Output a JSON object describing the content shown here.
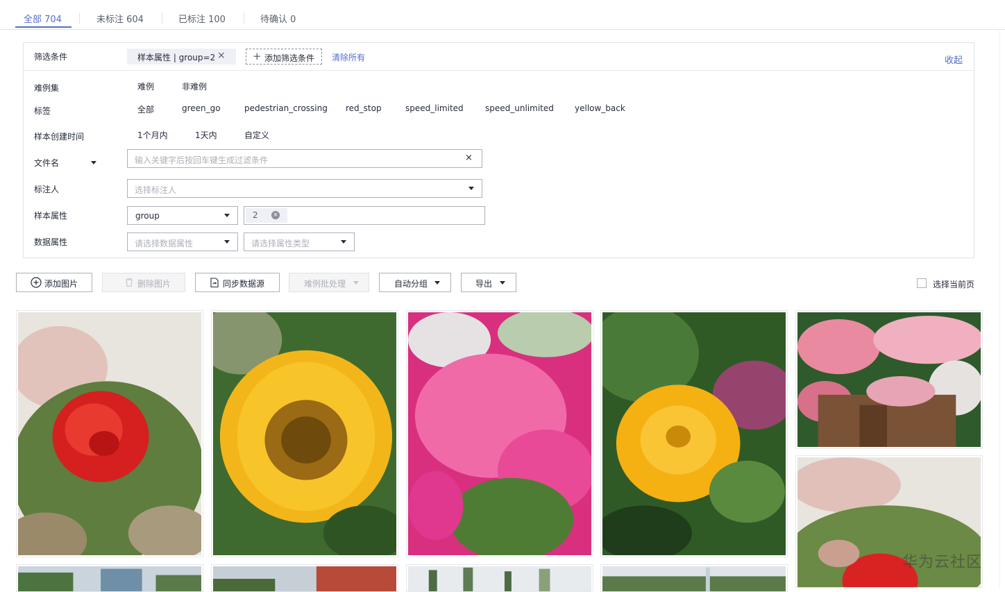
{
  "tabs": [
    {
      "label": "全部 704",
      "active": true
    },
    {
      "label": "未标注 604",
      "active": false
    },
    {
      "label": "已标注 100",
      "active": false
    },
    {
      "label": "待确认 0",
      "active": false
    }
  ],
  "filter": {
    "conditions_label": "筛选条件",
    "active_chip": "样本属性 | group=2",
    "add_condition": "添加筛选条件",
    "clear_all": "清除所有",
    "collapse": "收起",
    "hard_example_label": "难例集",
    "hard_example_options": [
      "难例",
      "非难例"
    ],
    "tags_label": "标签",
    "tag_options": [
      "全部",
      "green_go",
      "pedestrian_crossing",
      "red_stop",
      "speed_limited",
      "speed_unlimited",
      "yellow_back"
    ],
    "created_time_label": "样本创建时间",
    "created_time_options": [
      "1个月内",
      "1天内",
      "自定义"
    ],
    "filename_label": "文件名",
    "filename_placeholder": "输入关键字后按回车键生成过滤条件",
    "annotator_label": "标注人",
    "annotator_placeholder": "选择标注人",
    "sample_attr_label": "样本属性",
    "sample_attr_key": "group",
    "sample_attr_value": "2",
    "data_attr_label": "数据属性",
    "data_attr_placeholder": "请选择数据属性",
    "attr_type_placeholder": "请选择属性类型"
  },
  "toolbar": {
    "add_image": "添加图片",
    "delete_image": "删除图片",
    "sync_source": "同步数据源",
    "hard_batch": "难例批处理",
    "auto_group": "自动分组",
    "export": "导出",
    "select_page": "选择当前页"
  },
  "gallery": [
    {
      "subject": "red rose",
      "colors": [
        "#d92323",
        "#5b7a3a",
        "#e6e2dc"
      ]
    },
    {
      "subject": "sunflower",
      "colors": [
        "#f2b51b",
        "#8a5a12",
        "#3f6a2e"
      ]
    },
    {
      "subject": "pink cineraria",
      "colors": [
        "#e0378f",
        "#f27ab8",
        "#4d7a36"
      ]
    },
    {
      "subject": "yellow zinnia",
      "colors": [
        "#f5b213",
        "#3f6d2c",
        "#1f3d1a"
      ]
    },
    {
      "subject": "rose garden cart",
      "colors": [
        "#e98aa0",
        "#2f5a2c",
        "#7a5236"
      ]
    },
    {
      "subject": "red rose",
      "colors": [
        "#d92323",
        "#6b8a45",
        "#e6e2dc"
      ]
    },
    {
      "subject": "garden",
      "colors": [
        "#6f8fa8",
        "#4d7340",
        "#c9d4dc"
      ]
    },
    {
      "subject": "garden",
      "colors": [
        "#c7cfd6",
        "#b84a3a",
        "#4a6a3a"
      ]
    },
    {
      "subject": "cactus",
      "colors": [
        "#e7ebee",
        "#4d6b45",
        "#8aa07a"
      ]
    },
    {
      "subject": "garden",
      "colors": [
        "#c5d0d8",
        "#5a7a4a",
        "#e0e4e8"
      ]
    }
  ],
  "watermark": "华为云社区"
}
